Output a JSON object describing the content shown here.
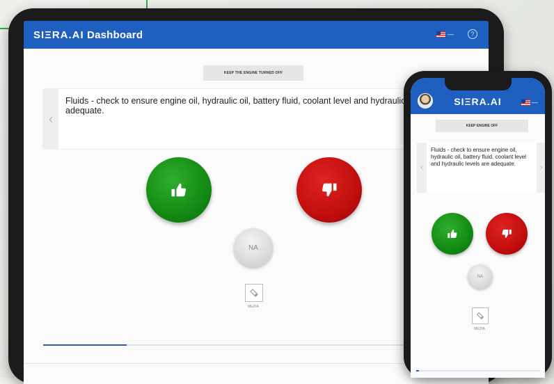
{
  "tablet": {
    "header": {
      "logo": "SIΞRA.AI",
      "title": "Dashboard",
      "lang_dash": "—",
      "help": "?"
    },
    "banner": "KEEP THE ENGINE TURNED OFF",
    "question": "Fluids - check to ensure engine oil, hydraulic oil, battery fluid, coolant level and hydraulic levels are adequate.",
    "nav_prev": "‹",
    "na_label": "NA",
    "media_label": "MEDIA",
    "progress": 0.2
  },
  "phone": {
    "header": {
      "logo": "SIΞRA.AI",
      "lang_dash": "—"
    },
    "banner": "KEEP ENGINE OFF",
    "question": "Fluids - check to ensure engine oil, hydraulic oil, battery fluid, coolant level and hydraulic levels are adequate.",
    "nav_prev": "‹",
    "nav_next": "›",
    "na_label": "NA",
    "media_label": "MEDIA",
    "progress": 0.02
  },
  "colors": {
    "brand_blue": "#1f5fbf",
    "approve_green": "#138a14",
    "reject_red": "#c10e0e",
    "accent_green": "#3fa34d"
  },
  "icons": {
    "approve": "thumbs-up-icon",
    "reject": "thumbs-down-icon",
    "media": "media-icon",
    "flag": "us-flag-icon",
    "help": "help-icon"
  }
}
